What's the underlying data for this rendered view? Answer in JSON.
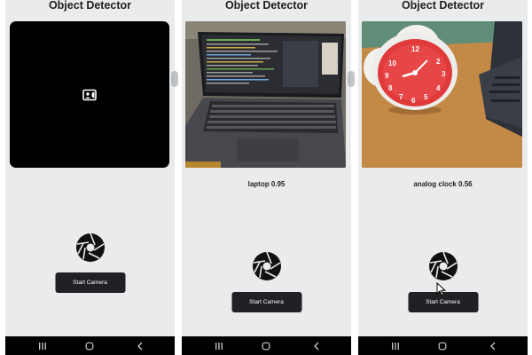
{
  "screens": [
    {
      "title": "Object Detector",
      "preview": "empty-preview",
      "result": "",
      "button_label": "Start Camera"
    },
    {
      "title": "Object Detector",
      "preview": "laptop-photo",
      "result": "laptop 0.95",
      "button_label": "Start Camera"
    },
    {
      "title": "Object Detector",
      "preview": "clock-photo",
      "result": "analog clock 0.56",
      "button_label": "Start Camera"
    }
  ],
  "icons": {
    "preview_placeholder": "video-camera-icon",
    "capture": "shutter-icon",
    "nav_recents": "recents-icon",
    "nav_home": "home-icon",
    "nav_back": "back-icon",
    "pointer": "cursor-icon"
  },
  "colors": {
    "app_background": "#e9ebed",
    "button_background": "#202124",
    "button_text": "#ffffff",
    "preview_background": "#000000",
    "navbar": "#000000"
  }
}
